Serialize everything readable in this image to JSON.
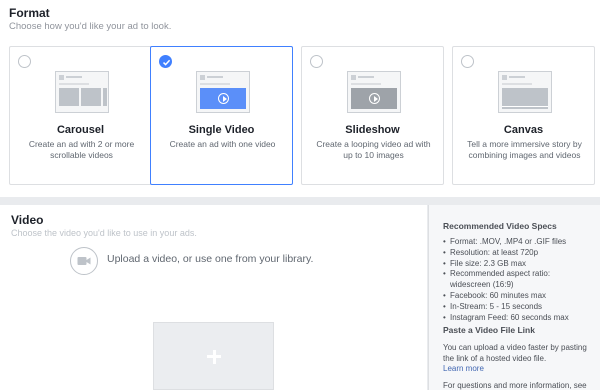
{
  "format": {
    "title": "Format",
    "subtitle": "Choose how you'd like your ad to look.",
    "options": [
      {
        "label": "Carousel",
        "description": "Create an ad with 2 or more scrollable videos",
        "selected": false
      },
      {
        "label": "Single Video",
        "description": "Create an ad with one video",
        "selected": true
      },
      {
        "label": "Slideshow",
        "description": "Create a looping video ad with up to 10 images",
        "selected": false
      },
      {
        "label": "Canvas",
        "description": "Tell a more immersive story by combining images and videos",
        "selected": false
      }
    ]
  },
  "video": {
    "title": "Video",
    "subtitle": "Choose the video you'd like to use in your ads.",
    "upload_text": "Upload a video, or use one from your library.",
    "upload_icon": "video-camera-icon",
    "add_icon": "plus-icon"
  },
  "specs": {
    "title": "Recommended Video Specs",
    "items": [
      "Format: .MOV, .MP4 or .GIF files",
      "Resolution: at least 720p",
      "File size: 2.3 GB max",
      "Recommended aspect ratio:",
      "widescreen (16:9)",
      "Facebook: 60 minutes max",
      "In-Stream: 5 - 15 seconds",
      "Instagram Feed: 60 seconds max"
    ],
    "paste_title": "Paste a Video File Link",
    "paste_text": "You can upload a video faster by pasting the link of a hosted video file.",
    "learn_more": "Learn more",
    "questions": "For questions and more information, see"
  },
  "colors": {
    "accent": "#4080ff",
    "link": "#4267b2",
    "video_thumb": "#5b8ff9"
  }
}
